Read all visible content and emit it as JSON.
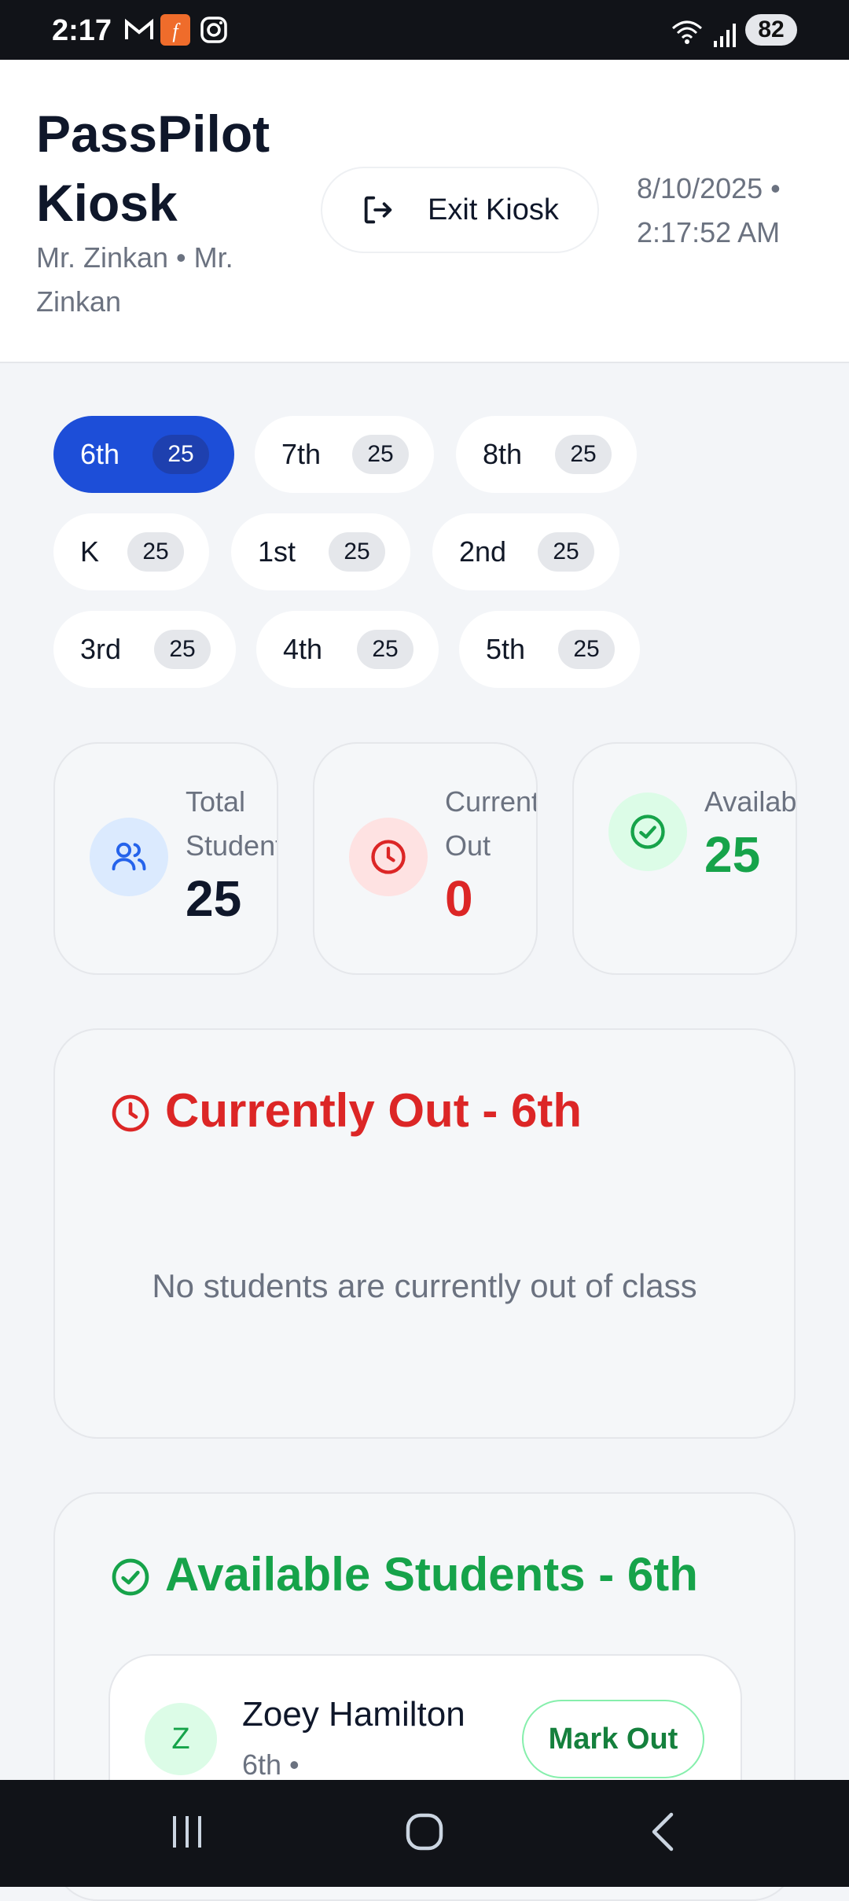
{
  "status_bar": {
    "time": "2:17",
    "battery": "82"
  },
  "header": {
    "title_line1": "PassPilot",
    "title_line2": "Kiosk",
    "teacher": "Mr. Zinkan • Mr. Zinkan",
    "exit_label": "Exit Kiosk",
    "date": "8/10/2025 •",
    "time": "2:17:52 AM"
  },
  "grades": [
    {
      "label": "6th",
      "count": "25",
      "active": true
    },
    {
      "label": "7th",
      "count": "25"
    },
    {
      "label": "8th",
      "count": "25"
    },
    {
      "label": "K",
      "count": "25"
    },
    {
      "label": "1st",
      "count": "25"
    },
    {
      "label": "2nd",
      "count": "25"
    },
    {
      "label": "3rd",
      "count": "25"
    },
    {
      "label": "4th",
      "count": "25"
    },
    {
      "label": "5th",
      "count": "25"
    }
  ],
  "stats": {
    "total": {
      "label": "Total Students",
      "value": "25"
    },
    "out": {
      "label": "Currently Out",
      "value": "0"
    },
    "available": {
      "label": "Available",
      "value": "25"
    }
  },
  "currently_out": {
    "title": "Currently Out - 6th",
    "empty_message": "No students are currently out of class"
  },
  "available_students": {
    "title": "Available Students - 6th",
    "students": [
      {
        "initial": "Z",
        "name": "Zoey Hamilton",
        "meta": "6th •",
        "action": "Mark Out"
      }
    ]
  },
  "colors": {
    "primary": "#1d4ed8",
    "danger": "#dc2626",
    "success": "#16a34a"
  },
  "icons": {
    "exit": "exit-icon",
    "users": "users-icon",
    "clock": "clock-icon",
    "check": "check-circle-icon"
  }
}
